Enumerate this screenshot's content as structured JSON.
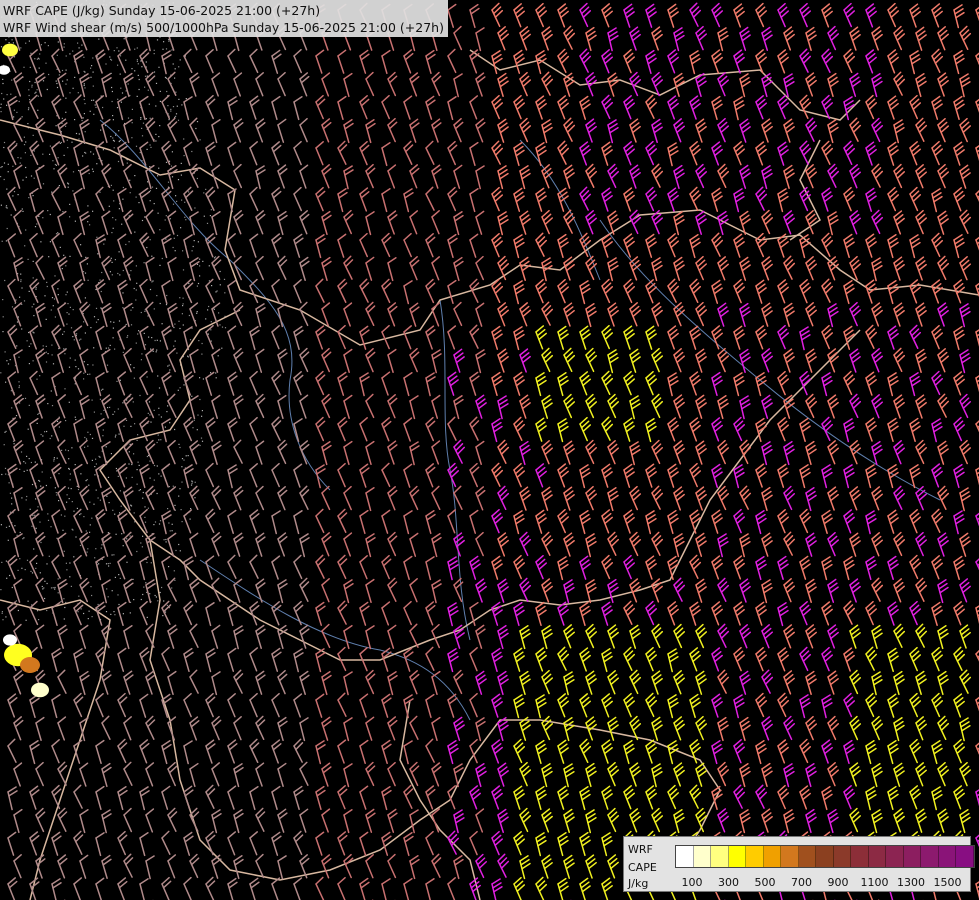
{
  "titles": {
    "line1": "WRF CAPE (J/kg) Sunday 15-06-2025 21:00 (+27h)",
    "line2": "WRF Wind shear (m/s) 500/1000hPa Sunday 15-06-2025 21:00 (+27h)"
  },
  "legend": {
    "model": "WRF",
    "variable": "CAPE",
    "unit": "J/kg",
    "colors": [
      "#ffffff",
      "#ffffcc",
      "#ffff80",
      "#ffff00",
      "#ffcc00",
      "#f0a000",
      "#d2781e",
      "#a0501e",
      "#8b4020",
      "#8b3a2a",
      "#8c2e38",
      "#8c2a44",
      "#8c2452",
      "#8c1e60",
      "#8c1a6e",
      "#8a1478",
      "#880e82"
    ],
    "tick_labels": [
      "100",
      "300",
      "500",
      "700",
      "900",
      "1100",
      "1300",
      "1500"
    ]
  },
  "barb_colors": {
    "low": "#b08a8a",
    "mid": "#c87070",
    "high": "#f07a6a",
    "magenta": "#e020e0",
    "yellow": "#f0f020"
  },
  "map_colors": {
    "background": "#000000",
    "borders": "#d8b8a0",
    "rivers": "#5f7fae",
    "terrain_shade": "#9a9a9a"
  }
}
